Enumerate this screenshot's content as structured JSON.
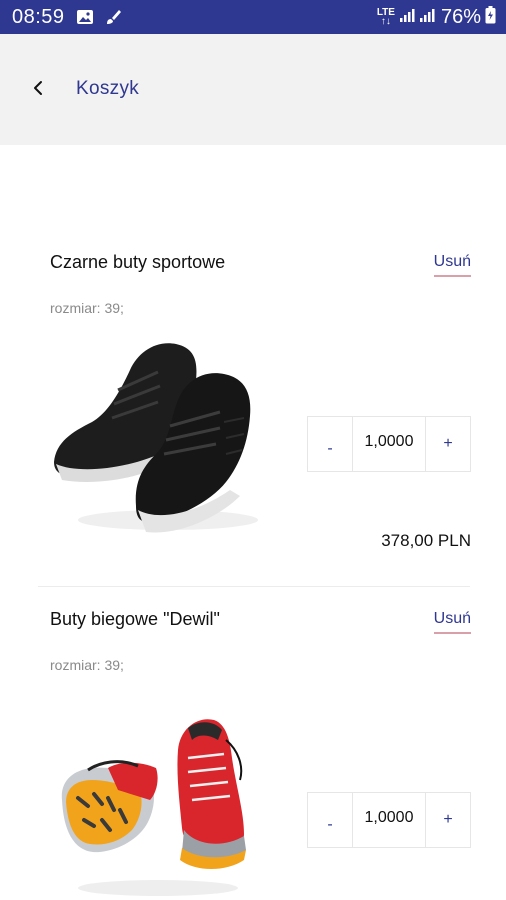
{
  "status_bar": {
    "time": "08:59",
    "network": "LTE",
    "battery": "76%",
    "icons": [
      "image-icon",
      "brush-icon",
      "signal-icon",
      "signal-icon",
      "battery-icon"
    ]
  },
  "toolbar": {
    "back_icon": "chevron-left-icon",
    "title": "Koszyk"
  },
  "cart": {
    "items": [
      {
        "name": "Czarne buty sportowe",
        "remove_label": "Usuń",
        "size": "rozmiar: 39;",
        "minus_label": "-",
        "quantity": "1,0000",
        "plus_label": "+",
        "price": "378,00 PLN"
      },
      {
        "name": "Buty biegowe \"Dewil\"",
        "remove_label": "Usuń",
        "size": "rozmiar: 39;",
        "minus_label": "-",
        "quantity": "1,0000",
        "plus_label": "+"
      }
    ]
  },
  "colors": {
    "accent": "#2f3891",
    "status_bar": "#2f3891",
    "toolbar_bg": "#f2f2f2",
    "remove_underline": "#d9a0aa"
  }
}
